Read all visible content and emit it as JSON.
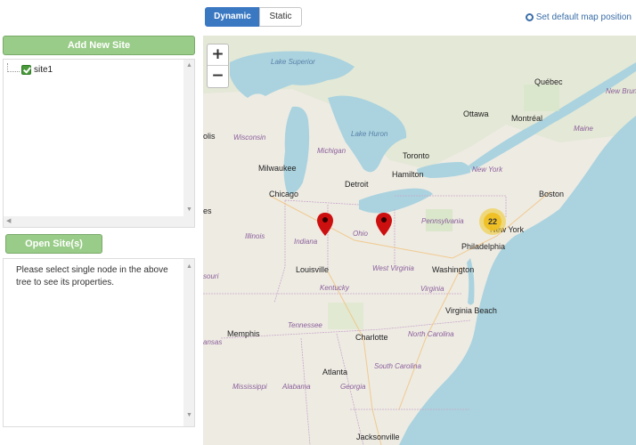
{
  "sidebar": {
    "add_site_label": "Add New Site",
    "tree": {
      "items": [
        {
          "label": "site1",
          "checked": true
        }
      ]
    },
    "open_site_label": "Open Site(s)",
    "properties_text": "Please select single node in the above tree to see its properties."
  },
  "toolbar": {
    "dynamic_label": "Dynamic",
    "static_label": "Static",
    "set_default_label": "Set default map position",
    "accent": "#3a78c2"
  },
  "map": {
    "zoom_in": "+",
    "zoom_out": "−",
    "cluster_count": "22",
    "marker_color": "#cc1010",
    "labels": {
      "lake_superior": "Lake Superior",
      "lake_huron": "Lake Huron",
      "michigan": "Michigan",
      "quebec": "Québec",
      "new_brunswick": "New Brunswick",
      "ottawa": "Ottawa",
      "montreal": "Montréal",
      "maine": "Maine",
      "wisconsin": "Wisconsin",
      "olis": "olis",
      "toronto": "Toronto",
      "milwaukee": "Milwaukee",
      "hamilton": "Hamilton",
      "new_york_state": "New York",
      "detroit": "Detroit",
      "chicago": "Chicago",
      "boston": "Boston",
      "es": "es",
      "pennsylvania": "Pennsylvania",
      "illinois": "Illinois",
      "indiana": "Indiana",
      "ohio": "Ohio",
      "new_york_city": "New York",
      "philadelphia": "Philadelphia",
      "louisville": "Louisville",
      "west_virginia": "West Virginia",
      "washington": "Washington",
      "souri": "souri",
      "kentucky": "Kentucky",
      "virginia": "Virginia",
      "virginia_beach": "Virginia Beach",
      "tennessee": "Tennessee",
      "memphis": "Memphis",
      "charlotte": "Charlotte",
      "north_carolina": "North Carolina",
      "ansas": "ansas",
      "south_carolina": "South Carolina",
      "atlanta": "Atlanta",
      "mississippi": "Mississippi",
      "alabama": "Alabama",
      "georgia": "Georgia",
      "jacksonville": "Jacksonville"
    }
  }
}
